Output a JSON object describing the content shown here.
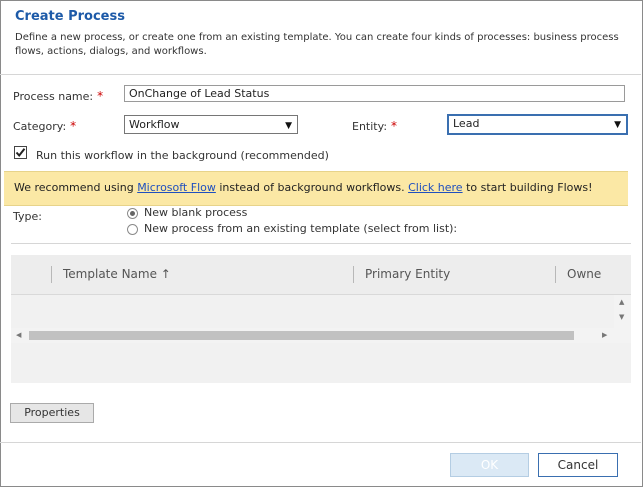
{
  "dialog": {
    "title": "Create Process",
    "description": "Define a new process, or create one from an existing template. You can create four kinds of processes: business process flows, actions, dialogs, and workflows."
  },
  "form": {
    "process_name_label": "Process name:",
    "process_name_value": "OnChange of Lead Status",
    "category_label": "Category:",
    "category_value": "Workflow",
    "entity_label": "Entity:",
    "entity_value": "Lead",
    "required_marker": "*",
    "background_checkbox_label": "Run this workflow in the background (recommended)",
    "background_checked": true
  },
  "banner": {
    "text_before": "We recommend using ",
    "link1": "Microsoft Flow",
    "text_middle": " instead of background workflows. ",
    "link2": "Click here",
    "text_after": " to start building Flows!"
  },
  "type": {
    "label": "Type:",
    "options": [
      {
        "label": "New blank process",
        "selected": true
      },
      {
        "label": "New process from an existing template (select from list):",
        "selected": false
      }
    ]
  },
  "grid": {
    "columns": [
      "Template Name ↑",
      "Primary Entity",
      "Owne"
    ]
  },
  "buttons": {
    "properties": "Properties",
    "ok": "OK",
    "cancel": "Cancel"
  },
  "icons": {
    "dropdown": "caret-down-icon",
    "sort": "sort-ascending-icon",
    "scroll_up": "scroll-up-icon",
    "scroll_down": "scroll-down-icon",
    "scroll_left": "scroll-left-icon",
    "scroll_right": "scroll-right-icon"
  }
}
